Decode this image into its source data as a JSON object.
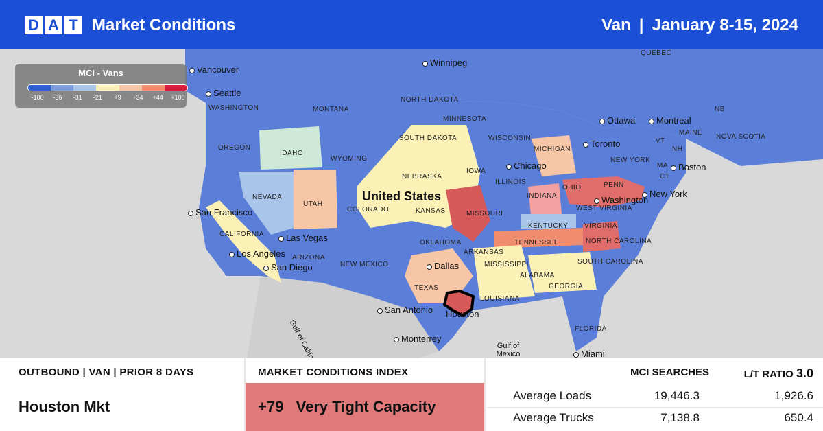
{
  "header": {
    "logo_letters": [
      "D",
      "A",
      "T"
    ],
    "title": "Market Conditions",
    "equipment": "Van",
    "separator": "|",
    "date_range": "January 8-15, 2024"
  },
  "legend": {
    "title": "MCI - Vans",
    "ticks": [
      "-100",
      "-36",
      "-31",
      "-21",
      "+9",
      "+34",
      "+44",
      "+100"
    ],
    "colors": [
      "#2f5fd0",
      "#7b9de0",
      "#a9c6ea",
      "#fbf1b7",
      "#f6c6a6",
      "#f08d6e",
      "#d61e3c"
    ]
  },
  "map": {
    "country_label": "United States",
    "cities": [
      "Vancouver",
      "Seattle",
      "Winnipeg",
      "Ottawa",
      "Montreal",
      "Toronto",
      "Boston",
      "New York",
      "Washington",
      "Chicago",
      "San Francisco",
      "Las Vegas",
      "Los Angeles",
      "San Diego",
      "Dallas",
      "San Antonio",
      "Houston",
      "Monterrey",
      "Miami"
    ],
    "states": [
      "WASHINGTON",
      "OREGON",
      "IDAHO",
      "MONTANA",
      "WYOMING",
      "NORTH DAKOTA",
      "SOUTH DAKOTA",
      "NEBRASKA",
      "NEVADA",
      "UTAH",
      "COLORADO",
      "CALIFORNIA",
      "ARIZONA",
      "NEW MEXICO",
      "KANSAS",
      "OKLAHOMA",
      "TEXAS",
      "MINNESOTA",
      "IOWA",
      "MISSOURI",
      "ARKANSAS",
      "LOUISIANA",
      "WISCONSIN",
      "ILLINOIS",
      "MICHIGAN",
      "INDIANA",
      "OHIO",
      "KENTUCKY",
      "TENNESSEE",
      "MISSISSIPPI",
      "ALABAMA",
      "GEORGIA",
      "FLORIDA",
      "SOUTH CAROLINA",
      "NORTH CAROLINA",
      "VIRGINIA",
      "WEST VIRGINIA",
      "PENN",
      "NEW YORK",
      "VT",
      "NH",
      "MA",
      "CT",
      "MAINE",
      "QUEBEC",
      "NOVA SCOTIA",
      "NB"
    ],
    "water": [
      "Gulf of California",
      "Gulf of Mexico"
    ]
  },
  "panel": {
    "outbound_title": "OUTBOUND | VAN | PRIOR 8 DAYS",
    "market_name": "Houston Mkt",
    "mci_title": "MARKET CONDITIONS INDEX",
    "mci_value": "+79",
    "mci_label": "Very Tight Capacity",
    "mci_color": "#e07a7a",
    "searches_title": "MCI SEARCHES",
    "ratio_title": "L/T RATIO",
    "ratio_value": "3.0",
    "rows": [
      {
        "label": "Average Loads",
        "searches": "19,446.3",
        "ratio": "1,926.6"
      },
      {
        "label": "Average Trucks",
        "searches": "7,138.8",
        "ratio": "650.4"
      }
    ]
  }
}
